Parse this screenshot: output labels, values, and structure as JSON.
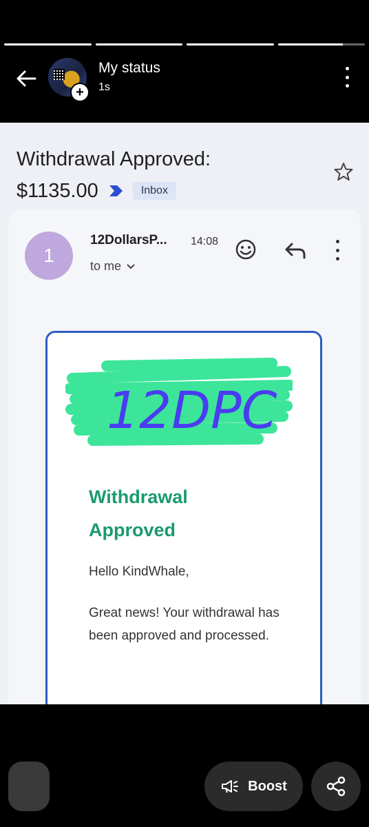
{
  "status": {
    "progress": [
      1.0,
      1.0,
      1.0,
      0.75
    ],
    "title": "My status",
    "time": "1s"
  },
  "email": {
    "subject_line1": "Withdrawal Approved:",
    "subject_amount": "$1135.00",
    "label": "Inbox",
    "sender_initial": "1",
    "sender_name": "12DollarsP...",
    "time": "14:08",
    "recipient": "to me",
    "logo_text": "12DPC",
    "heading": "Withdrawal Approved",
    "greeting": "Hello KindWhale,",
    "body": "Great news! Your withdrawal has been approved and processed."
  },
  "actions": {
    "boost_label": "Boost"
  },
  "colors": {
    "accent_green": "#1a9b6c",
    "border_blue": "#2e5bc4",
    "sender_avatar": "#bfa8dd"
  },
  "icons": [
    "back-arrow-icon",
    "add-icon",
    "more-vert-icon",
    "label-chevron-icon",
    "star-icon",
    "emoji-icon",
    "reply-icon",
    "dropdown-caret-icon",
    "megaphone-icon",
    "share-icon"
  ]
}
